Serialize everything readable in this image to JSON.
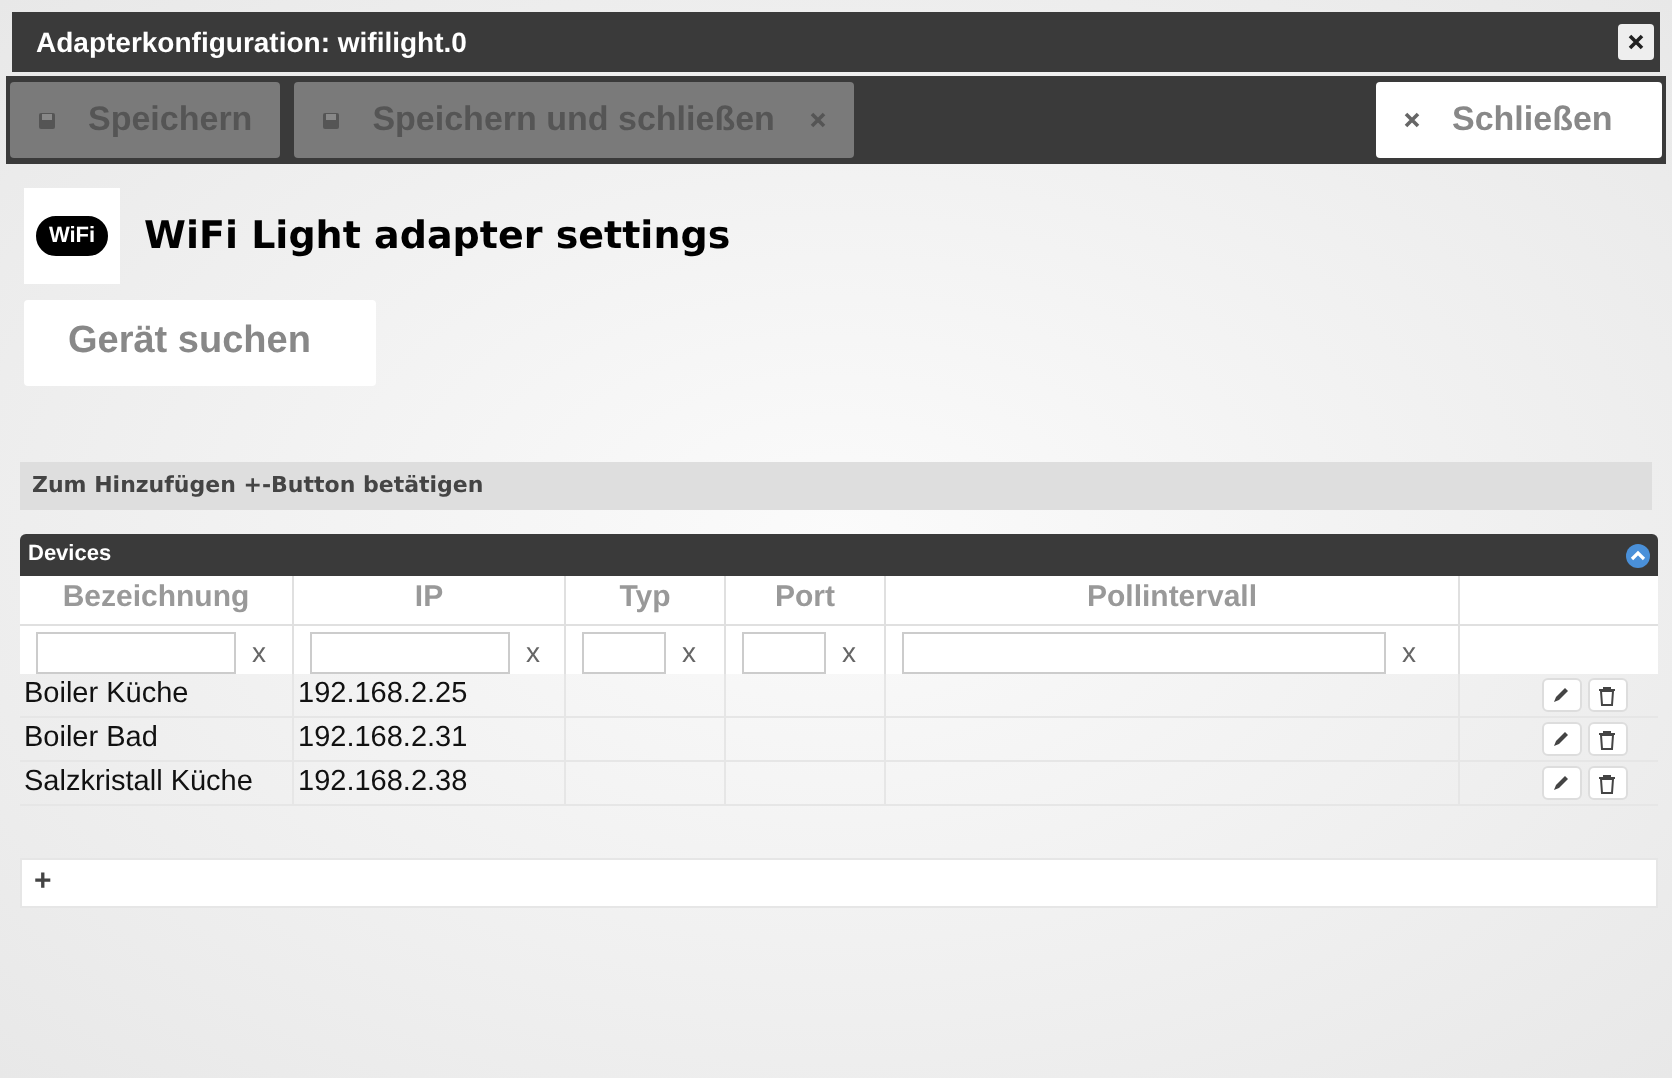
{
  "window": {
    "title": "Adapterkonfiguration: wifilight.0"
  },
  "toolbar": [
    {
      "label": "Speichern",
      "kind": "save",
      "disabled": true
    },
    {
      "label": "Speichern und schließen",
      "kind": "save-close",
      "disabled": true
    },
    {
      "label": "Schließen",
      "kind": "close",
      "disabled": false
    }
  ],
  "header": {
    "title": "WiFi Light adapter settings",
    "logo_text": "WiFi"
  },
  "search_button": {
    "label": "Gerät suchen"
  },
  "hint": "Zum Hinzufügen +-Button betätigen",
  "table": {
    "title": "Devices",
    "columns": [
      {
        "label": "Bezeichnung",
        "clear": "x"
      },
      {
        "label": "IP",
        "clear": "x"
      },
      {
        "label": "Typ",
        "clear": "x"
      },
      {
        "label": "Port",
        "clear": "x"
      },
      {
        "label": "Pollintervall",
        "clear": "x"
      }
    ],
    "rows": [
      {
        "cells": [
          "Boiler Küche",
          "192.168.2.25",
          "",
          "",
          ""
        ]
      },
      {
        "cells": [
          "Boiler Bad",
          "192.168.2.31",
          "",
          "",
          ""
        ]
      },
      {
        "cells": [
          "Salzkristall Küche",
          "192.168.2.38",
          "",
          "",
          ""
        ]
      }
    ],
    "add_button": "+"
  }
}
